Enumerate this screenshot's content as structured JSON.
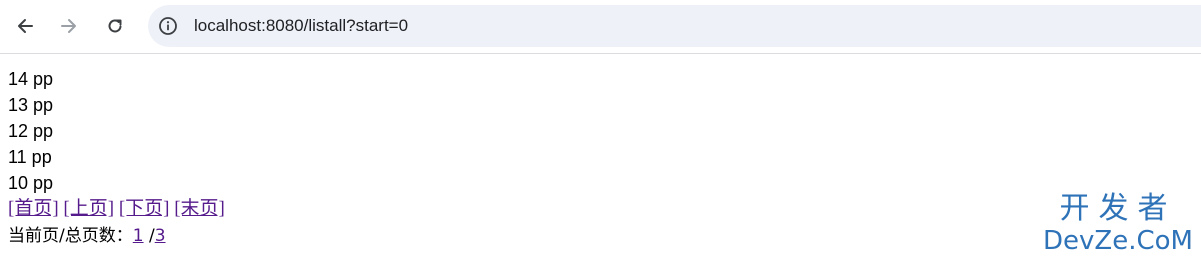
{
  "browser": {
    "url": "localhost:8080/listall?start=0",
    "icons": {
      "back": "arrow-left-icon",
      "forward": "arrow-right-icon",
      "reload": "reload-icon",
      "site_info": "info-icon"
    }
  },
  "items": [
    {
      "text": "14 pp"
    },
    {
      "text": "13 pp"
    },
    {
      "text": "12 pp"
    },
    {
      "text": "11 pp"
    },
    {
      "text": "10 pp"
    }
  ],
  "pagination": {
    "first": "[首页]",
    "prev": "[上页]",
    "next": "[下页]",
    "last": "[末页]"
  },
  "page_info": {
    "label": "当前页/总页数：",
    "current": "1",
    "separator": "/",
    "total": "3"
  },
  "watermark": {
    "line1": "开发者",
    "line2": "DevZe.CoM",
    "color": "#2e72b8"
  },
  "colors": {
    "link": "#551a8b",
    "omnibox_bg": "#eef1f8"
  }
}
